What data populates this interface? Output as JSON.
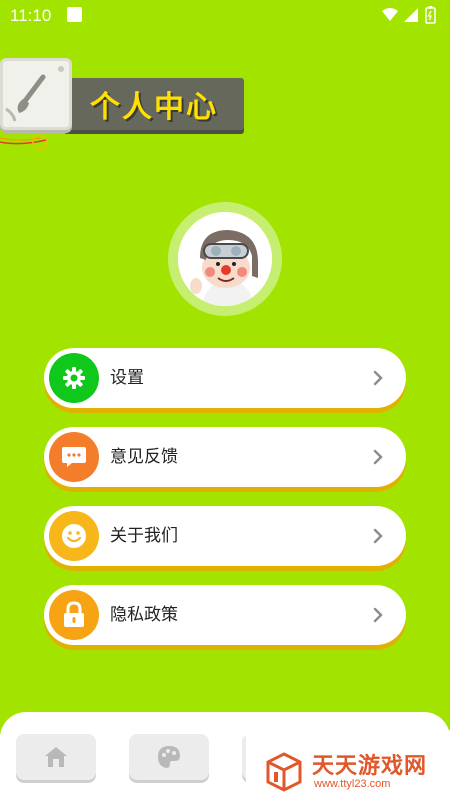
{
  "status_bar": {
    "time": "11:10"
  },
  "header": {
    "title": "个人中心"
  },
  "menu": [
    {
      "label": "设置",
      "icon": "gear-icon",
      "color": "#10c81c"
    },
    {
      "label": "意见反馈",
      "icon": "chat-icon",
      "color": "#f47d2c"
    },
    {
      "label": "关于我们",
      "icon": "smile-icon",
      "color": "#f7b61a"
    },
    {
      "label": "隐私政策",
      "icon": "lock-icon",
      "color": "#f7a313"
    }
  ],
  "watermark": {
    "title": "天天游戏网",
    "url": "www.ttyl23.com"
  },
  "colors": {
    "background": "#a2e400",
    "title_text": "#ffe000",
    "item_shadow": "#e0b200"
  }
}
